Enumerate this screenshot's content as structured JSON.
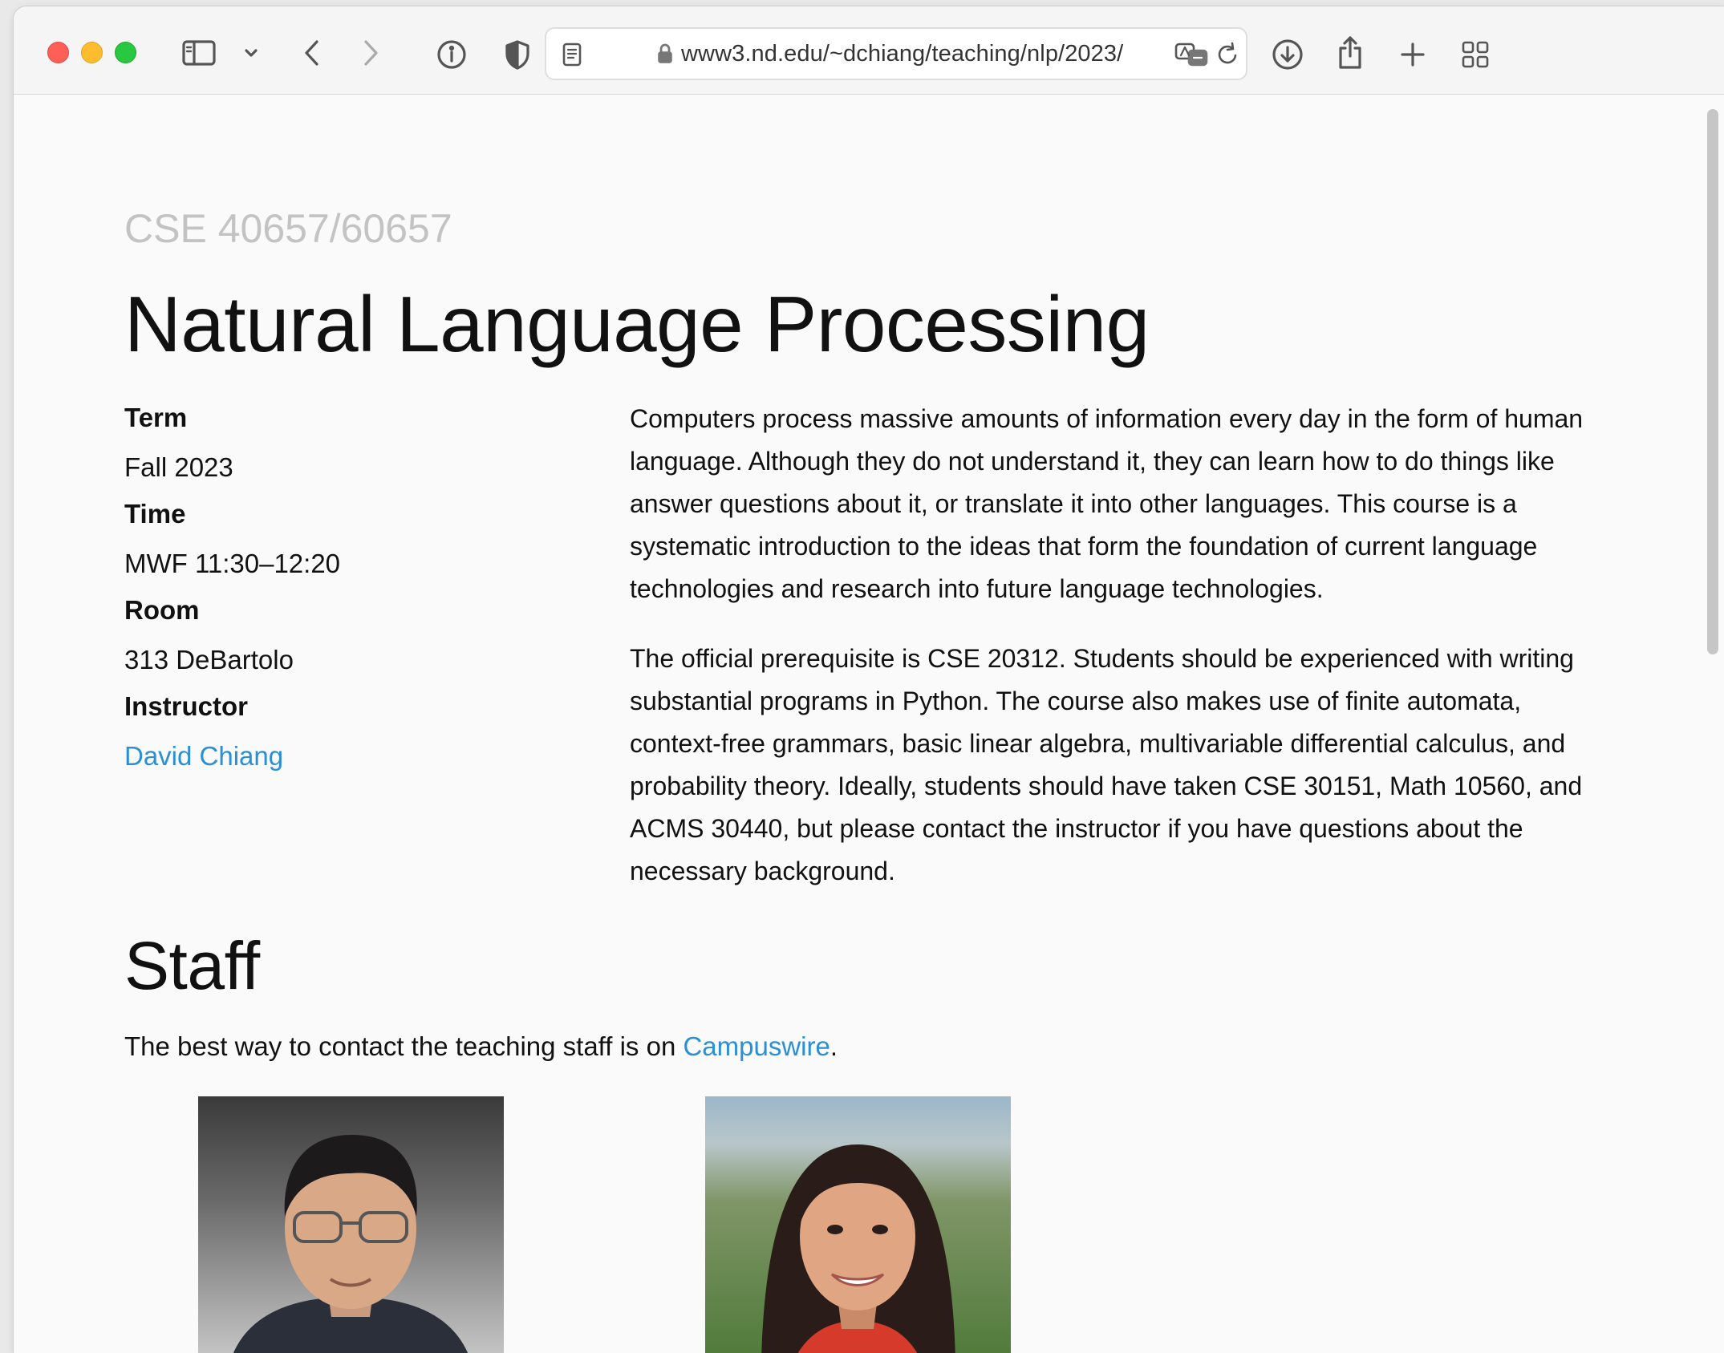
{
  "browser": {
    "url": "www3.nd.edu/~dchiang/teaching/nlp/2023/"
  },
  "page": {
    "course_code": "CSE 40657/60657",
    "title": "Natural Language Processing",
    "meta": [
      {
        "label": "Term",
        "value": "Fall 2023"
      },
      {
        "label": "Time",
        "value": "MWF 11:30–12:20"
      },
      {
        "label": "Room",
        "value": "313 DeBartolo"
      },
      {
        "label": "Instructor",
        "value": "David Chiang"
      }
    ],
    "description": [
      "Computers process massive amounts of information every day in the form of human language. Although they do not understand it, they can learn how to do things like answer questions about it, or translate it into other languages. This course is a systematic introduction to the ideas that form the foundation of current language technologies and research into future language technologies.",
      "The official prerequisite is CSE 20312. Students should be experienced with writing substantial programs in Python. The course also makes use of finite automata, context-free grammars, basic linear algebra, multivariable differential calculus, and probability theory. Ideally, students should have taken CSE 30151, Math 10560, and ACMS 30440, but please contact the instructor if you have questions about the necessary background."
    ],
    "staff": {
      "heading": "Staff",
      "intro_before": "The best way to contact the teaching staff is on ",
      "intro_link": "Campuswire",
      "intro_after": "."
    }
  },
  "colors": {
    "link": "#2a8fd4",
    "course_code": "#c3c3c3"
  }
}
